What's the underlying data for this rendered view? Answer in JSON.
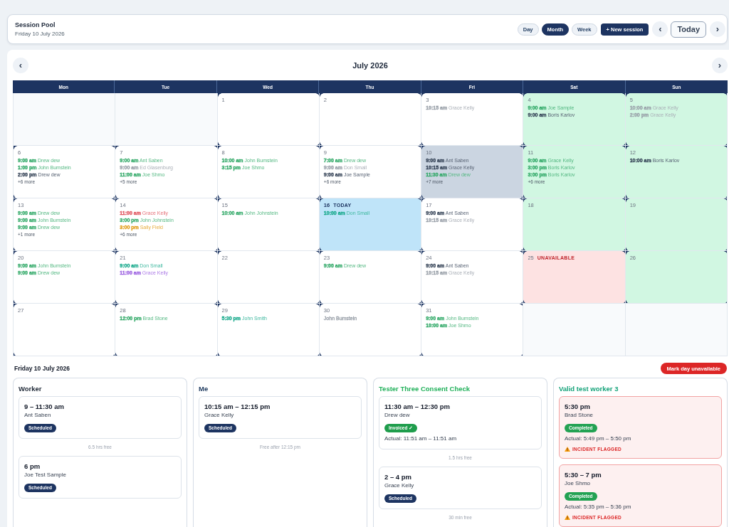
{
  "header": {
    "title": "Session Pool",
    "subtitle": "Friday 10 July 2026",
    "views": [
      {
        "label": "Day",
        "selected": false
      },
      {
        "label": "Month",
        "selected": true
      },
      {
        "label": "Week",
        "selected": false
      }
    ],
    "new_session": "+ New session",
    "prev": "‹",
    "today": "Today",
    "next": "›"
  },
  "calendar": {
    "prev": "‹",
    "title": "July 2026",
    "next": "›",
    "weekdays": [
      "Mon",
      "Tue",
      "Wed",
      "Thu",
      "Fri",
      "Sat",
      "Sun"
    ],
    "weeks": [
      {
        "days": [
          {
            "kind": "outside",
            "selected": false
          },
          {
            "kind": "outside",
            "selected": false
          },
          {
            "date": "1",
            "kind": "plain",
            "selected": false
          },
          {
            "date": "2",
            "kind": "plain",
            "selected": false
          },
          {
            "date": "3",
            "kind": "plain",
            "selected": false,
            "events": [
              {
                "time": "10:15 am",
                "name": "Grace Kelly",
                "color": "#979ea7"
              }
            ]
          },
          {
            "date": "4",
            "kind": "available",
            "selected": false,
            "events": [
              {
                "time": "9:00 am",
                "name": "Joe Sample",
                "color": "#2fa866"
              },
              {
                "time": "9:00 am",
                "name": "Boris Karlov",
                "color": "#334155"
              }
            ]
          },
          {
            "date": "5",
            "kind": "available",
            "selected": false,
            "events": [
              {
                "time": "10:00 am",
                "name": "Grace Kelly",
                "color": "#979ea7"
              },
              {
                "time": "2:00 pm",
                "name": "Grace Kelly",
                "color": "#979ea7"
              }
            ]
          }
        ]
      },
      {
        "days": [
          {
            "date": "6",
            "kind": "plain",
            "selected": false,
            "events": [
              {
                "time": "9:00 am",
                "name": "Drew dew",
                "color": "#2fa866"
              },
              {
                "time": "1:00 pm",
                "name": "John Bumstein",
                "color": "#2fa866"
              },
              {
                "time": "2:00 pm",
                "name": "Drew dew",
                "color": "#334155"
              }
            ],
            "more": "+6 more"
          },
          {
            "date": "7",
            "kind": "plain",
            "selected": false,
            "events": [
              {
                "time": "9:00 am",
                "name": "Ant Saben",
                "color": "#2fa866"
              },
              {
                "time": "9:00 am",
                "name": "Ed Glasenburg",
                "color": "#979ea7"
              },
              {
                "time": "11:00 am",
                "name": "Joe Shmo",
                "color": "#2fa866"
              }
            ],
            "more": "+5 more"
          },
          {
            "date": "8",
            "kind": "plain",
            "selected": false,
            "events": [
              {
                "time": "10:00 am",
                "name": "John Bumstein",
                "color": "#2fa866"
              },
              {
                "time": "3:15 pm",
                "name": "Joe Shmo",
                "color": "#2fa866"
              }
            ]
          },
          {
            "date": "9",
            "kind": "plain",
            "selected": false,
            "events": [
              {
                "time": "7:00 am",
                "name": "Drew dew",
                "color": "#2fa866"
              },
              {
                "time": "9:00 am",
                "name": "Don Small",
                "color": "#979ea7"
              },
              {
                "time": "9:00 am",
                "name": "Joe Sample",
                "color": "#334155"
              }
            ],
            "more": "+6 more"
          },
          {
            "date": "10",
            "kind": "plain",
            "selected": true,
            "events": [
              {
                "time": "9:00 am",
                "name": "Ant Saben",
                "color": "#334155"
              },
              {
                "time": "10:15 am",
                "name": "Grace Kelly",
                "color": "#334155"
              },
              {
                "time": "11:30 am",
                "name": "Drew dew",
                "color": "#2fa866"
              }
            ],
            "more": "+7 more"
          },
          {
            "date": "11",
            "kind": "available",
            "selected": false,
            "events": [
              {
                "time": "9:00 am",
                "name": "Grace Kelly",
                "color": "#2fa866"
              },
              {
                "time": "3:00 pm",
                "name": "Boris Karlov",
                "color": "#2fa866"
              },
              {
                "time": "3:00 pm",
                "name": "Boris Karlov",
                "color": "#2fa866"
              }
            ],
            "more": "+6 more"
          },
          {
            "date": "12",
            "kind": "available",
            "selected": false,
            "events": [
              {
                "time": "10:00 am",
                "name": "Boris Karlov",
                "color": "#334155"
              }
            ]
          }
        ]
      },
      {
        "days": [
          {
            "date": "13",
            "kind": "plain",
            "selected": false,
            "events": [
              {
                "time": "9:00 am",
                "name": "Drew dew",
                "color": "#2fa866"
              },
              {
                "time": "9:00 am",
                "name": "John Bumstein",
                "color": "#2fa866"
              },
              {
                "time": "9:00 am",
                "name": "Drew dew",
                "color": "#2fa866"
              }
            ],
            "more": "+1 more"
          },
          {
            "date": "14",
            "kind": "plain",
            "selected": false,
            "events": [
              {
                "time": "11:00 am",
                "name": "Grace Kelly",
                "color": "#e0525c"
              },
              {
                "time": "3:00 pm",
                "name": "John Johnstein",
                "color": "#2fa866"
              },
              {
                "time": "3:00 pm",
                "name": "Sally Field",
                "color": "#e09a12"
              }
            ],
            "more": "+6 more"
          },
          {
            "date": "15",
            "kind": "plain",
            "selected": false,
            "events": [
              {
                "time": "10:00 am",
                "name": "John Johnstein",
                "color": "#2fa866"
              }
            ]
          },
          {
            "date": "16",
            "kind": "today",
            "badge": "TODAY",
            "selected": false,
            "events": [
              {
                "time": "10:00 am",
                "name": "Don Small",
                "color": "#14a88a"
              }
            ]
          },
          {
            "date": "17",
            "kind": "plain",
            "selected": false,
            "events": [
              {
                "time": "9:00 am",
                "name": "Ant Saben",
                "color": "#334155"
              },
              {
                "time": "10:15 am",
                "name": "Grace Kelly",
                "color": "#979ea7"
              }
            ]
          },
          {
            "date": "18",
            "kind": "available",
            "selected": false
          },
          {
            "date": "19",
            "kind": "available",
            "selected": false
          }
        ]
      },
      {
        "days": [
          {
            "date": "20",
            "kind": "plain",
            "selected": false,
            "events": [
              {
                "time": "9:00 am",
                "name": "John Bumstein",
                "color": "#2fa866"
              },
              {
                "time": "9:00 am",
                "name": "Drew dew",
                "color": "#2fa866"
              }
            ]
          },
          {
            "date": "21",
            "kind": "plain",
            "selected": false,
            "events": [
              {
                "time": "9:00 am",
                "name": "Don Small",
                "color": "#14a88a"
              },
              {
                "time": "11:00 am",
                "name": "Grace Kelly",
                "color": "#9a5ee0"
              }
            ]
          },
          {
            "date": "22",
            "kind": "plain",
            "selected": false
          },
          {
            "date": "23",
            "kind": "plain",
            "selected": false,
            "events": [
              {
                "time": "9:00 am",
                "name": "Drew dew",
                "color": "#2fa866"
              }
            ]
          },
          {
            "date": "24",
            "kind": "plain",
            "selected": false,
            "events": [
              {
                "time": "9:00 am",
                "name": "Ant Saben",
                "color": "#334155"
              },
              {
                "time": "10:15 am",
                "name": "Grace Kelly",
                "color": "#979ea7"
              }
            ]
          },
          {
            "date": "25",
            "kind": "unavailable",
            "badge": "UNAVAILABLE",
            "selected": false
          },
          {
            "date": "26",
            "kind": "available",
            "selected": false
          }
        ]
      },
      {
        "days": [
          {
            "date": "27",
            "kind": "plain",
            "selected": false
          },
          {
            "date": "28",
            "kind": "plain",
            "selected": false,
            "events": [
              {
                "time": "12:00 pm",
                "name": "Brad Stone",
                "color": "#2fa866"
              }
            ]
          },
          {
            "date": "29",
            "kind": "plain",
            "selected": false,
            "events": [
              {
                "time": "5:30 pm",
                "name": "John Smith",
                "color": "#14a88a"
              }
            ]
          },
          {
            "date": "30",
            "kind": "plain",
            "selected": false,
            "events": [
              {
                "name": "John Bumstein",
                "color": "#979ea7"
              }
            ]
          },
          {
            "date": "31",
            "kind": "plain",
            "selected": false,
            "events": [
              {
                "time": "9:00 am",
                "name": "John Bumstein",
                "color": "#2fa866"
              },
              {
                "time": "10:00 am",
                "name": "Joe Shmo",
                "color": "#2fa866"
              }
            ]
          },
          {
            "kind": "outside",
            "selected": false
          },
          {
            "kind": "outside",
            "selected": false
          }
        ]
      }
    ]
  },
  "day_detail": {
    "title": "Friday 10 July 2026",
    "action": "Mark day unavailable",
    "columns": [
      {
        "title": "Worker",
        "color": "#1f2937",
        "items": [
          {
            "kind": "session",
            "time": "9 – 11:30 am",
            "client": "Ant Saben",
            "badge": {
              "kind": "scheduled",
              "label": "Scheduled"
            },
            "flagged": false
          },
          {
            "kind": "gap",
            "text": "6.5 hrs free"
          },
          {
            "kind": "session",
            "time": "6 pm",
            "client": "Joe Test Sample",
            "badge": {
              "kind": "scheduled",
              "label": "Scheduled"
            },
            "flagged": false
          }
        ]
      },
      {
        "title": "Me",
        "color": "#1e3a5f",
        "items": [
          {
            "kind": "session",
            "time": "10:15 am – 12:15 pm",
            "client": "Grace Kelly",
            "badge": {
              "kind": "scheduled",
              "label": "Scheduled"
            },
            "flagged": false
          },
          {
            "kind": "gap",
            "text": "Free after 12:15 pm"
          }
        ]
      },
      {
        "title": "Tester Three Consent Check",
        "color": "#22b15b",
        "items": [
          {
            "kind": "session",
            "time": "11:30 am – 12:30 pm",
            "client": "Drew dew",
            "badge": {
              "kind": "invoiced",
              "label": "Invoiced ✓"
            },
            "actual": "Actual: 11:51 am – 11:51 am",
            "flagged": false
          },
          {
            "kind": "gap",
            "text": "1.5 hrs free"
          },
          {
            "kind": "session",
            "time": "2 – 4 pm",
            "client": "Grace Kelly",
            "badge": {
              "kind": "scheduled",
              "label": "Scheduled"
            },
            "flagged": false
          },
          {
            "kind": "gap",
            "text": "30 min free"
          }
        ]
      },
      {
        "title": "Valid test worker 3",
        "color": "#16a37a",
        "items": [
          {
            "kind": "session",
            "time": "5:30 pm",
            "client": "Brad Stone",
            "badge": {
              "kind": "completed",
              "label": "Completed"
            },
            "actual": "Actual: 5:49 pm – 5:50 pm",
            "flagged": true,
            "incident": "INCIDENT FLAGGED"
          },
          {
            "kind": "session",
            "time": "5:30 – 7 pm",
            "client": "Joe Shmo",
            "badge": {
              "kind": "completed",
              "label": "Completed"
            },
            "actual": "Actual: 5:35 pm – 5:36 pm",
            "flagged": true,
            "incident": "INCIDENT FLAGGED"
          }
        ]
      }
    ]
  }
}
